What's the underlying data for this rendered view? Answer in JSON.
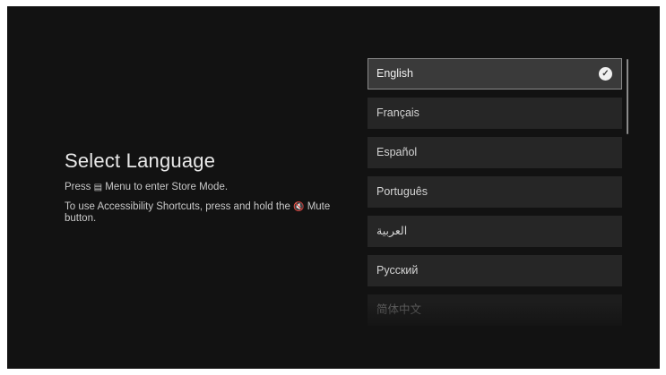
{
  "screen": {
    "title": "Select Language",
    "store_hint_pre": "Press ",
    "store_hint_icon": "menu-icon",
    "store_hint_post": " Menu to enter Store Mode.",
    "access_hint_pre": "To use Accessibility Shortcuts, press and hold the ",
    "access_hint_icon": "mute-icon",
    "access_hint_post": " Mute button."
  },
  "languages": [
    {
      "label": "English",
      "selected": true
    },
    {
      "label": "Français",
      "selected": false
    },
    {
      "label": "Español",
      "selected": false
    },
    {
      "label": "Português",
      "selected": false
    },
    {
      "label": "العربية",
      "selected": false
    },
    {
      "label": "Русский",
      "selected": false
    },
    {
      "label": "简体中文",
      "selected": false
    }
  ],
  "icons": {
    "selected_indicator": "checkmark-circle-icon"
  },
  "colors": {
    "background": "#121212",
    "item": "#262626",
    "selected_item": "#3a3a3a",
    "selected_border": "#8a8a8a",
    "text": "#d4d4d4"
  }
}
